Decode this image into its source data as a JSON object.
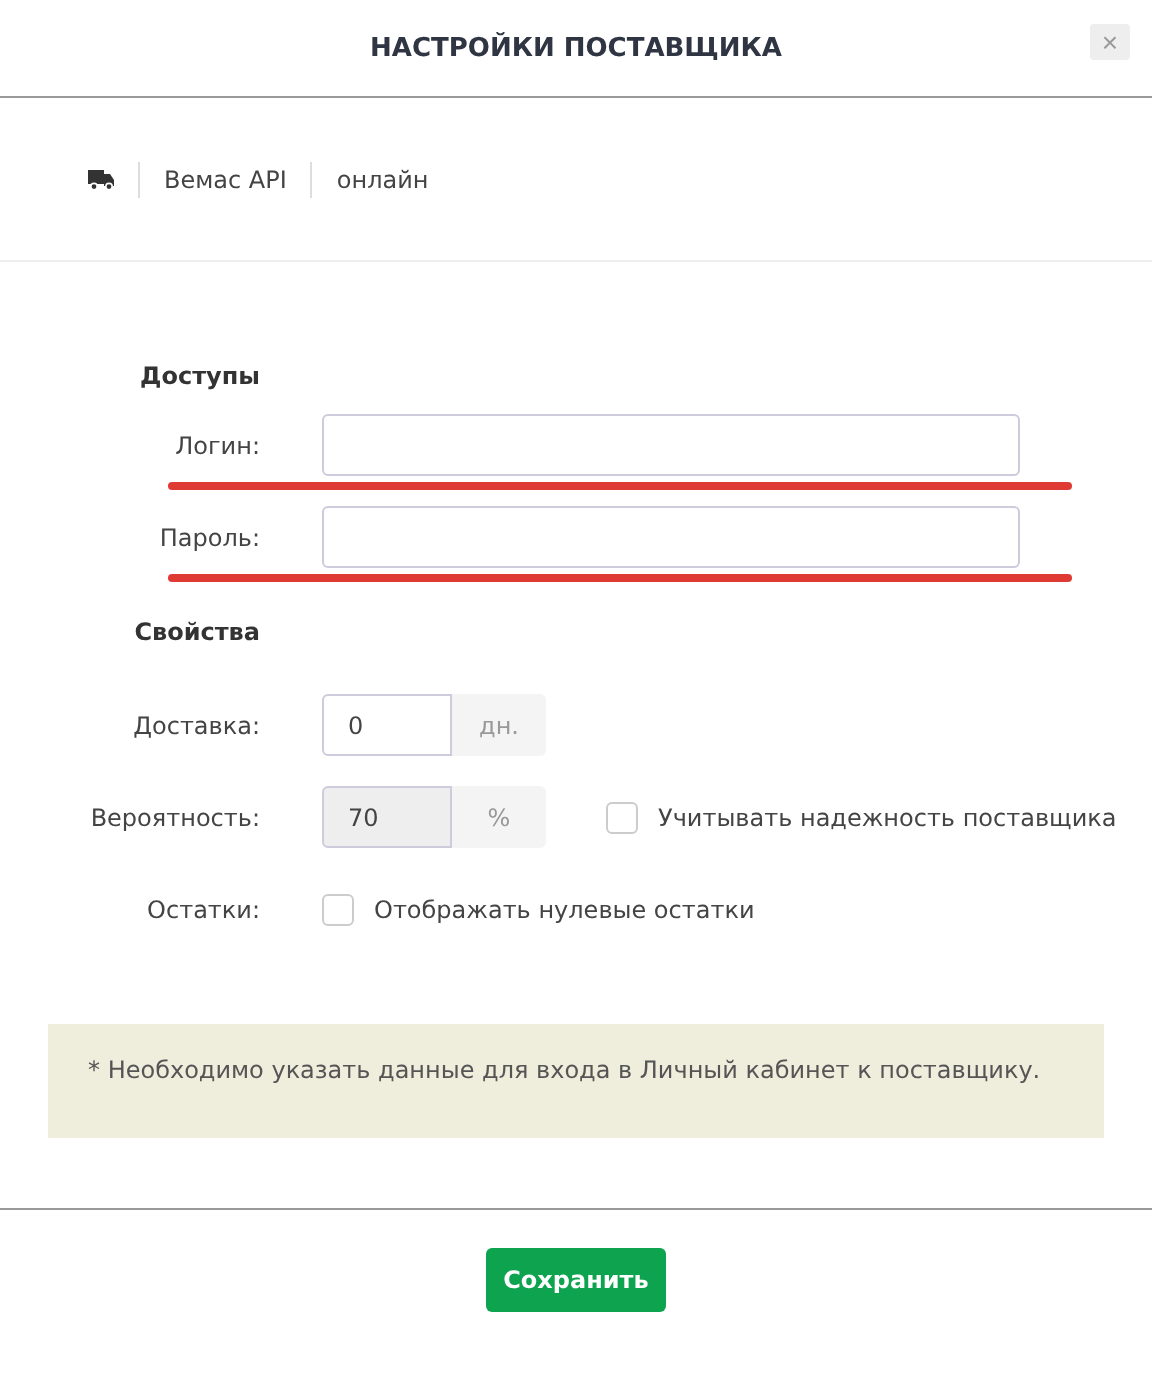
{
  "dialog": {
    "title": "НАСТРОЙКИ ПОСТАВЩИКА",
    "close_label": "×"
  },
  "supplier": {
    "name": "Вемас API",
    "status": "онлайн"
  },
  "sections": [
    {
      "title": "Доступы",
      "rows": [
        {
          "kind": "text",
          "label": "Логин:",
          "value": "",
          "underlined": true
        },
        {
          "kind": "text",
          "label": "Пароль:",
          "value": "",
          "underlined": true
        }
      ]
    },
    {
      "title": "Свойства",
      "rows": [
        {
          "kind": "addon",
          "label": "Доставка:",
          "value": "0",
          "addon": "дн.",
          "disabled": false
        },
        {
          "kind": "addon",
          "label": "Вероятность:",
          "value": "70",
          "addon": "%",
          "disabled": true,
          "checkbox": {
            "label": "Учитывать надежность поставщика",
            "checked": false
          }
        },
        {
          "kind": "checkbox",
          "label": "Остатки:",
          "checkbox": {
            "label": "Отображать нулевые остатки",
            "checked": false
          }
        }
      ]
    }
  ],
  "note": "* Необходимо указать данные для входа в Личный кабинет к поставщику.",
  "buttons": [
    "Сохранить"
  ]
}
